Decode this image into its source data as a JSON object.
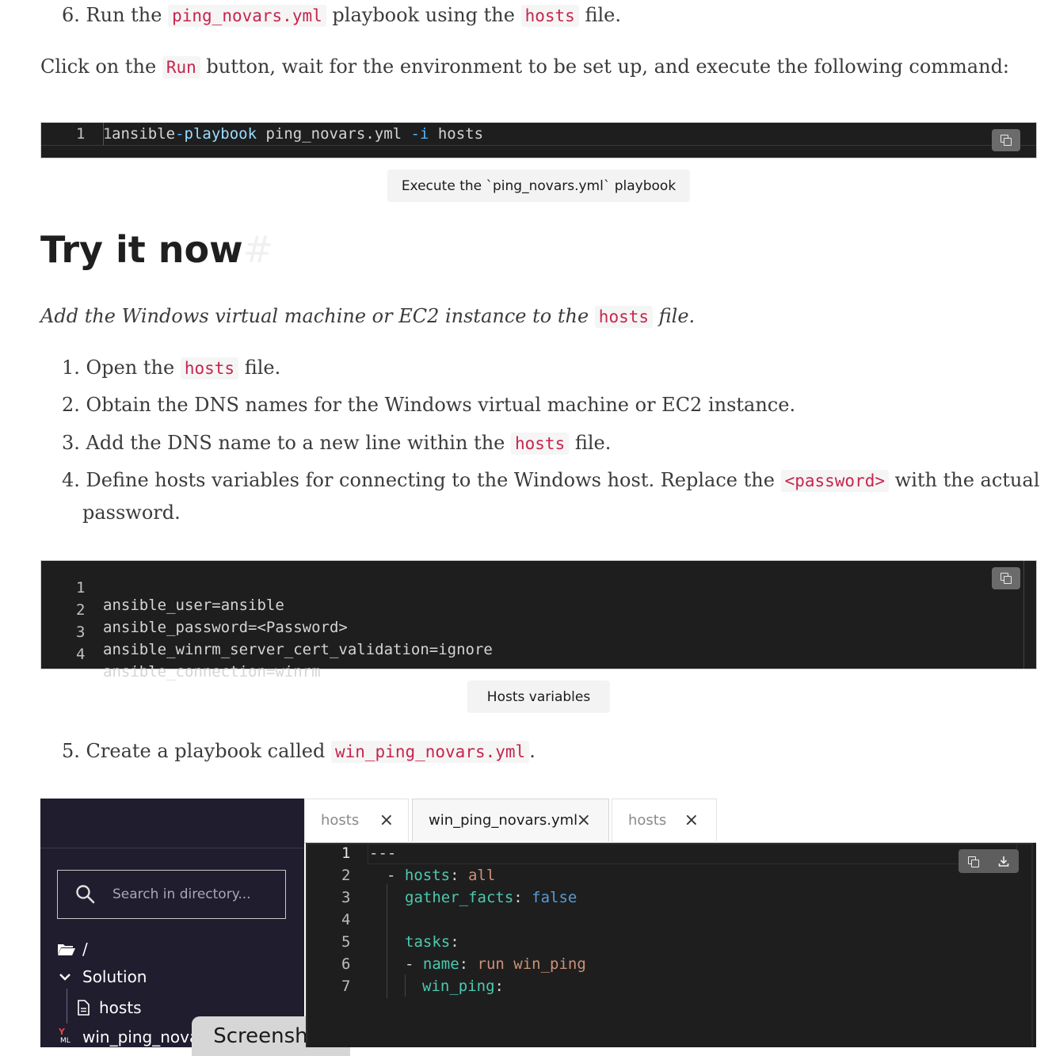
{
  "step6": {
    "num": "6.",
    "pre": "Run the",
    "code1": "ping_novars.yml",
    "mid": "playbook using the",
    "code2": "hosts",
    "post": "file."
  },
  "run_line": {
    "pre": "Click on the",
    "code": "Run",
    "post": "button, wait for the environment to be set up, and execute the following command:"
  },
  "cmd_block": {
    "line_no": "1",
    "cmd": "ansible",
    "op1": "-",
    "word": "playbook",
    "file": " ping_novars.yml ",
    "flag": "-i",
    "arg": " hosts",
    "caption": "Execute the `ping_novars.yml` playbook"
  },
  "heading": {
    "text": "Try it now",
    "anchor": "#"
  },
  "intro": {
    "pre": "Add the Windows virtual machine or EC2 instance to the",
    "code": "hosts",
    "post": "file."
  },
  "steps": [
    {
      "num": "1.",
      "pre": "Open the",
      "code": "hosts",
      "post": "file."
    },
    {
      "num": "2.",
      "pre": "Obtain the DNS names for the Windows virtual machine or EC2 instance."
    },
    {
      "num": "3.",
      "pre": "Add the DNS name to a new line within the",
      "code": "hosts",
      "post": "file."
    },
    {
      "num": "4.",
      "pre": "Define hosts variables for connecting to the Windows host. Replace the",
      "code": "<password>",
      "post": "with the actual",
      "cont": "password."
    }
  ],
  "vars_block": {
    "lines": [
      {
        "n": "1",
        "t": "ansible_user=ansible"
      },
      {
        "n": "2",
        "t": "ansible_password=<Password>"
      },
      {
        "n": "3",
        "t": "ansible_winrm_server_cert_validation=ignore"
      },
      {
        "n": "4",
        "t": "ansible_connection=winrm"
      }
    ],
    "caption": "Hosts variables"
  },
  "step5": {
    "num": "5.",
    "pre": "Create a playbook called",
    "code": "win_ping_novars.yml",
    "post": "."
  },
  "ide": {
    "search_placeholder": "Search in directory...",
    "root": "/",
    "folder": "Solution",
    "file1": "hosts",
    "file2": "win_ping_nova",
    "file2_badge": "ML",
    "tabs": [
      {
        "label": "hosts",
        "close": "×"
      },
      {
        "label": "win_ping_novars.yml",
        "close": "×"
      },
      {
        "label": "hosts",
        "close": "×"
      }
    ],
    "line_numbers": [
      "1",
      "2",
      "3",
      "4",
      "5",
      "6",
      "7"
    ],
    "code": {
      "l1": "---",
      "l2_dash": "- ",
      "l2_key": "hosts",
      "l2_colon": ": ",
      "l2_val": "all",
      "l3_key": "gather_facts",
      "l3_colon": ": ",
      "l3_val": "false",
      "l5_key": "tasks",
      "l5_colon": ":",
      "l6_dash": "- ",
      "l6_key": "name",
      "l6_colon": ": ",
      "l6_val": "run win_ping",
      "l7_key": "win_ping",
      "l7_colon": ":"
    },
    "screenshot_button": "Screenshot"
  }
}
